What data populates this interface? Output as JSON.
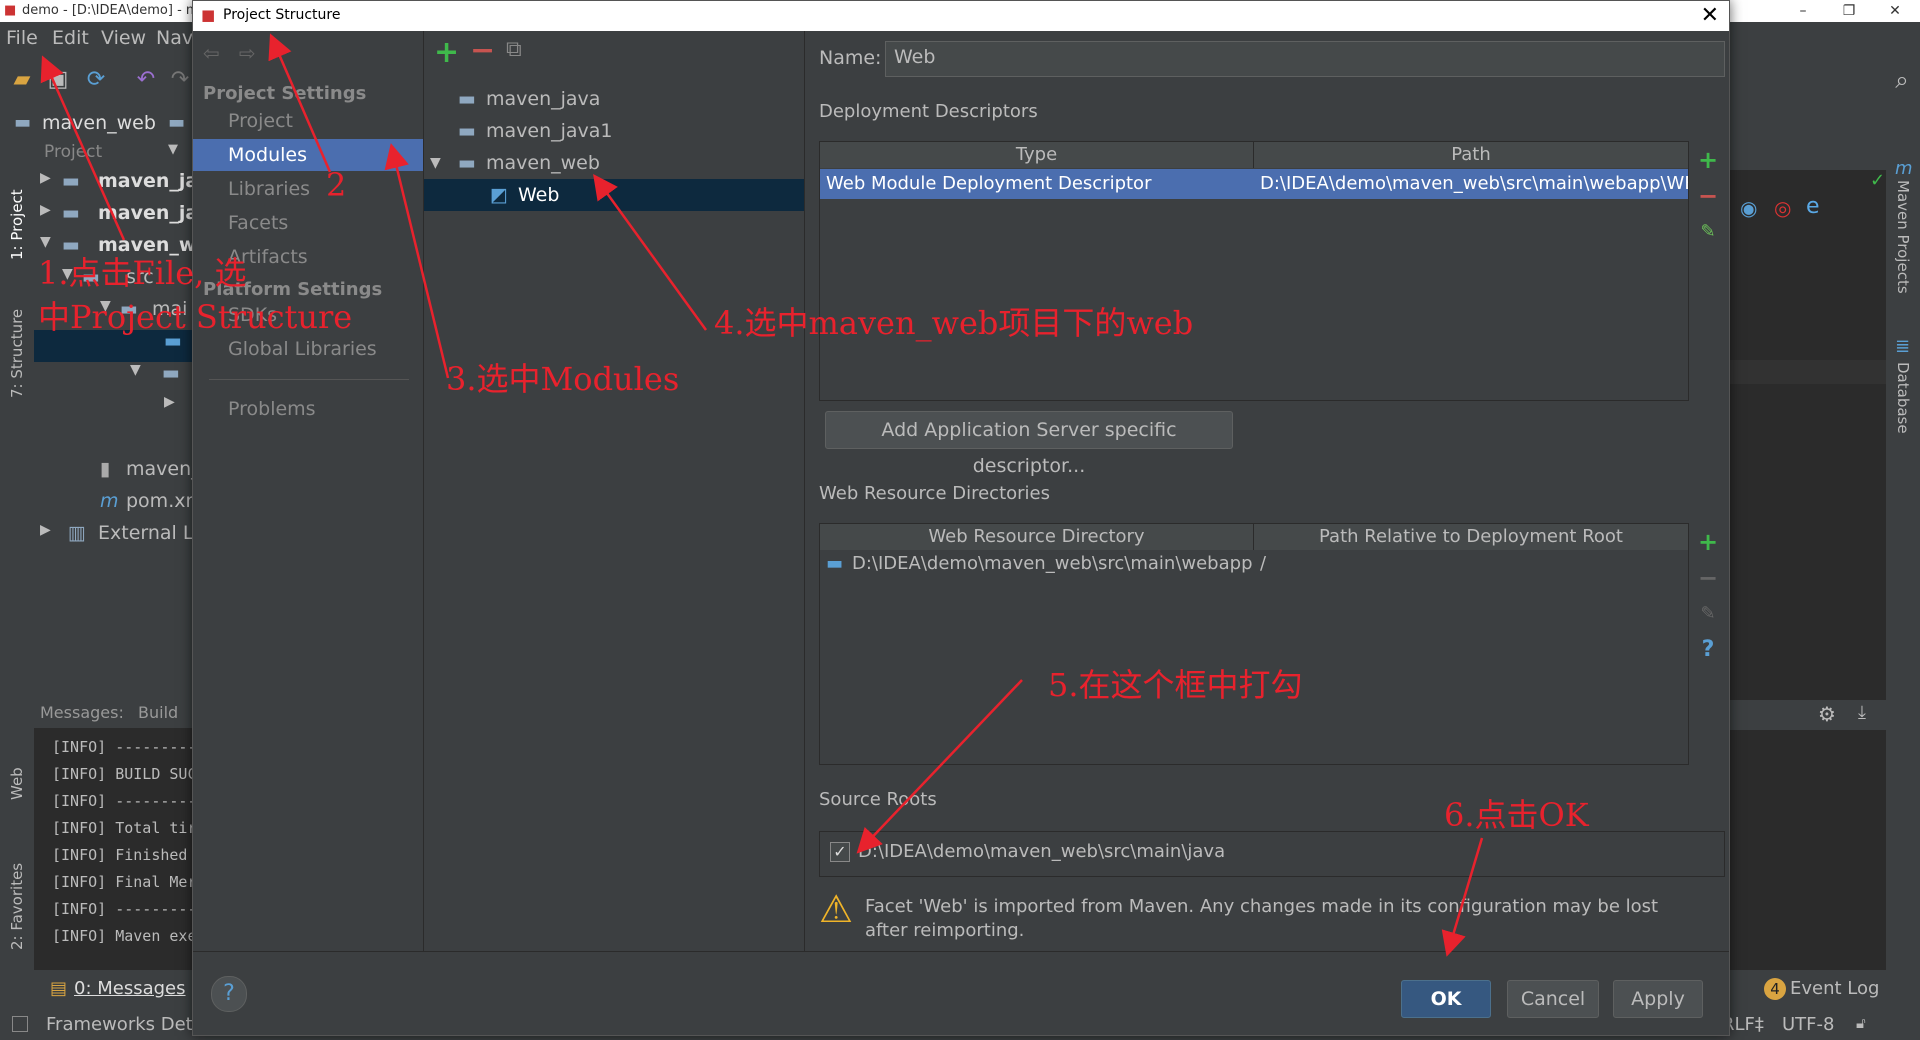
{
  "ide": {
    "window_title": "demo - [D:\\IDEA\\demo] - ma",
    "menu": [
      "File",
      "Edit",
      "View",
      "Nav"
    ],
    "breadcrumb_project": "maven_web",
    "project_dropdown": "Project",
    "left_tabs": [
      "1: Project",
      "7: Structure",
      "Web",
      "2: Favorites"
    ],
    "right_tabs": [
      "Maven Projects",
      "Database"
    ],
    "tree": [
      {
        "label": "maven_jav"
      },
      {
        "label": "maven_jav"
      },
      {
        "label": "maven_we"
      },
      {
        "label": "src"
      },
      {
        "label": "mai"
      },
      {
        "label": "maven_"
      },
      {
        "label": "pom.xn"
      },
      {
        "label": "External Lib"
      }
    ],
    "messages_header": "Messages:",
    "messages_tab": "Build",
    "messages": [
      "[INFO] ---------",
      "[INFO] BUILD SUC",
      "[INFO] ---------",
      "[INFO] Total tir",
      "[INFO] Finished",
      "[INFO] Final Mer",
      "[INFO] ---------",
      "[INFO] Maven exe"
    ],
    "bottom_tab": "0: Messages",
    "status_left": "Frameworks Dete",
    "status_crlf": "RLF‡",
    "status_encoding": "UTF-8",
    "event_log": "Event Log",
    "event_count": "4"
  },
  "dialog": {
    "title": "Project Structure",
    "project_settings_header": "Project Settings",
    "project_settings_items": [
      "Project",
      "Modules",
      "Libraries",
      "Facets",
      "Artifacts"
    ],
    "platform_settings_header": "Platform Settings",
    "platform_settings_items": [
      "SDKs",
      "Global Libraries"
    ],
    "problems": "Problems",
    "modules": [
      "maven_java",
      "maven_java1",
      "maven_web",
      "Web"
    ],
    "name_label": "Name:",
    "name_value": "Web",
    "deployment_descriptors": {
      "title": "Deployment Descriptors",
      "columns": [
        "Type",
        "Path"
      ],
      "rows": [
        [
          "Web Module Deployment Descriptor",
          "D:\\IDEA\\demo\\maven_web\\src\\main\\webapp\\WE"
        ]
      ]
    },
    "add_server_descriptor": "Add Application Server specific descriptor...",
    "web_resource_directories": {
      "title": "Web Resource Directories",
      "columns": [
        "Web Resource Directory",
        "Path Relative to Deployment Root"
      ],
      "rows": [
        [
          "D:\\IDEA\\demo\\maven_web\\src\\main\\webapp",
          "/"
        ]
      ]
    },
    "source_roots": {
      "title": "Source Roots",
      "path": "D:\\IDEA\\demo\\maven_web\\src\\main\\java",
      "checked": true
    },
    "warning": "Facet 'Web' is imported from Maven. Any changes made in its configuration may be lost after reimporting.",
    "buttons": {
      "ok": "OK",
      "cancel": "Cancel",
      "apply": "Apply"
    },
    "help": "?"
  },
  "annotations": {
    "step1_line1": "1.点击File, 选",
    "step1_line2": "中Project Structure",
    "step2": "2",
    "step3": "3.选中Modules",
    "step4": "4.选中maven_web项目下的web",
    "step5": "5.在这个框中打勾",
    "step6": "6.点击OK"
  },
  "colors": {
    "selection": "#4b6eaf",
    "annotation": "#e8222d",
    "add": "#3fb94b",
    "remove": "#c75450"
  }
}
